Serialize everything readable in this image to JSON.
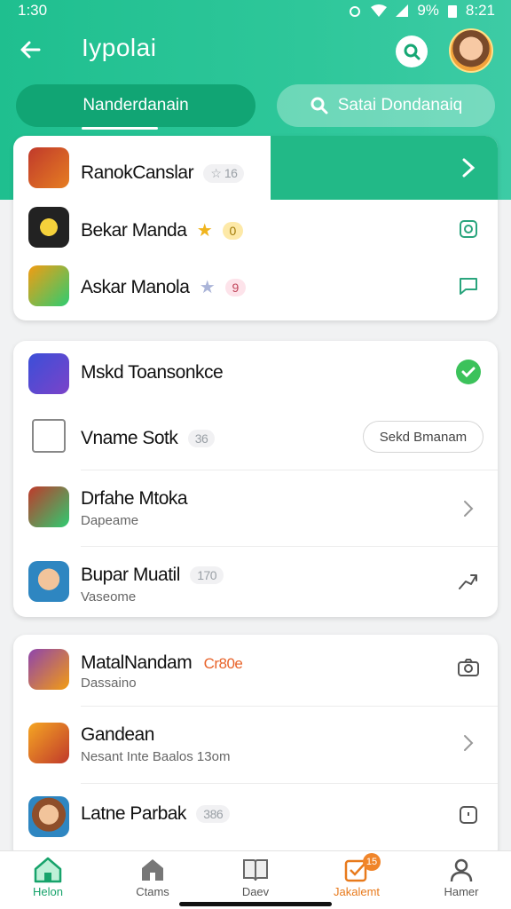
{
  "status": {
    "time": "1:30",
    "battery": "9%",
    "clock_right": "8:21"
  },
  "header": {
    "title": "Iypolai",
    "back_icon": "arrow-left-icon",
    "search_icon": "search-icon"
  },
  "tabs": {
    "active": "Nanderdanain",
    "inactive": "Satai Dondanaiq"
  },
  "card1": {
    "rows": [
      {
        "name": "RanokCanslar",
        "pill": "16",
        "pill_icon": "star-icon"
      },
      {
        "name": "Bekar Manda",
        "pill": "0",
        "pill_icon": "star-icon"
      },
      {
        "name": "Askar Manola",
        "pill": "9",
        "pill_icon": "star-icon"
      }
    ]
  },
  "card2": {
    "rows": [
      {
        "name": "Mskd Toansonkce"
      },
      {
        "name": "Vname Sotk",
        "pill": "36",
        "action_label": "Sekd Bmanam"
      },
      {
        "name": "Drfahe Mtoka",
        "sub": "Dapeame"
      },
      {
        "name": "Bupar Muatil",
        "pill": "170",
        "sub": "Vaseome"
      }
    ]
  },
  "card3": {
    "rows": [
      {
        "name": "MatalNandam",
        "badge": "Cr80e",
        "sub": "Dassaino"
      },
      {
        "name": "Gandean",
        "sub": "Nesant Inte Baalos 13om"
      },
      {
        "name": "Latne Parbak",
        "pill": "386"
      }
    ]
  },
  "nav": {
    "items": [
      {
        "label": "Helon",
        "icon": "home-icon"
      },
      {
        "label": "Ctams",
        "icon": "house-icon"
      },
      {
        "label": "Daev",
        "icon": "book-icon"
      },
      {
        "label": "Jakalemt",
        "icon": "checkbox-icon",
        "badge": "15"
      },
      {
        "label": "Hamer",
        "icon": "user-icon"
      }
    ]
  },
  "colors": {
    "brand": "#1fbf8f",
    "accent_orange": "#f0852a",
    "check_green": "#3cc25b"
  }
}
